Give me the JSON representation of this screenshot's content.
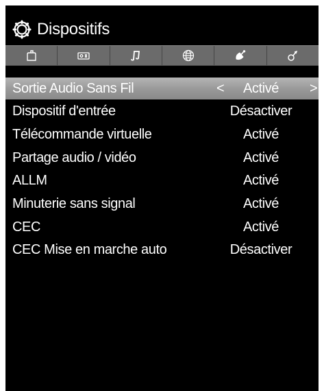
{
  "header": {
    "title": "Dispositifs",
    "icon": "gear-icon"
  },
  "tabs": [
    {
      "name": "picture-tab",
      "icon": "picture-icon"
    },
    {
      "name": "display-tab",
      "icon": "display-icon"
    },
    {
      "name": "sound-tab",
      "icon": "music-note-icon"
    },
    {
      "name": "network-tab",
      "icon": "globe-icon"
    },
    {
      "name": "setup-tab",
      "icon": "satellite-icon"
    },
    {
      "name": "devices-tab",
      "icon": "devices-icon"
    }
  ],
  "menu": {
    "items": [
      {
        "label": "Sortie Audio Sans Fil",
        "value": "Activé",
        "selected": true,
        "arrow_left": "<",
        "arrow_right": ">"
      },
      {
        "label": "Dispositif d'entrée",
        "value": "Désactiver",
        "selected": false
      },
      {
        "label": "Télécommande virtuelle",
        "value": "Activé",
        "selected": false
      },
      {
        "label": "Partage audio / vidéo",
        "value": "Activé",
        "selected": false
      },
      {
        "label": "ALLM",
        "value": "Activé",
        "selected": false
      },
      {
        "label": "Minuterie sans signal",
        "value": "Activé",
        "selected": false
      },
      {
        "label": "CEC",
        "value": "Activé",
        "selected": false
      },
      {
        "label": "CEC Mise en marche auto",
        "value": "Désactiver",
        "selected": false
      }
    ]
  },
  "colors": {
    "background": "#000000",
    "text": "#ffffff",
    "tabbar": "#6b6b6b",
    "selected_row": "#a5a5a5"
  }
}
